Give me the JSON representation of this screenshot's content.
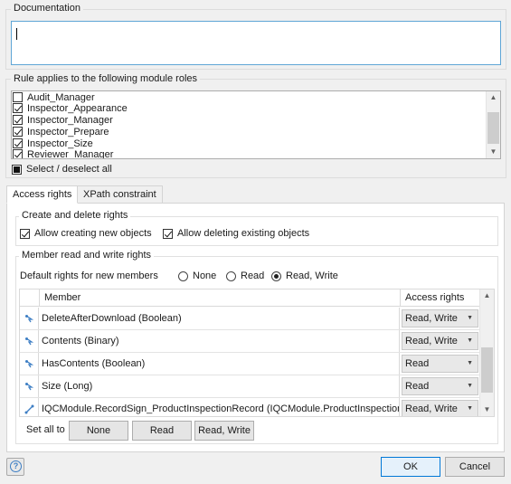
{
  "documentation": {
    "label": "Documentation",
    "value": ""
  },
  "roles": {
    "label": "Rule applies to the following module roles",
    "items": [
      {
        "label": "Audit_Manager",
        "checked": false
      },
      {
        "label": "Inspector_Appearance",
        "checked": true
      },
      {
        "label": "Inspector_Manager",
        "checked": true
      },
      {
        "label": "Inspector_Prepare",
        "checked": true
      },
      {
        "label": "Inspector_Size",
        "checked": true
      },
      {
        "label": "Reviewer_Manager",
        "checked": true
      }
    ],
    "select_all_label": "Select / deselect all"
  },
  "tabs": [
    {
      "label": "Access rights",
      "active": true
    },
    {
      "label": "XPath constraint",
      "active": false
    }
  ],
  "create_delete": {
    "title": "Create and delete rights",
    "allow_create_label": "Allow creating new objects",
    "allow_create_checked": true,
    "allow_delete_label": "Allow deleting existing objects",
    "allow_delete_checked": true
  },
  "member_rights": {
    "title": "Member read and write rights",
    "default_label": "Default rights for new members",
    "options": [
      "None",
      "Read",
      "Read, Write"
    ],
    "selected": "Read, Write",
    "columns": {
      "member": "Member",
      "access": "Access rights"
    },
    "rows": [
      {
        "icon": "attribute-icon",
        "member": "DeleteAfterDownload (Boolean)",
        "access": "Read, Write"
      },
      {
        "icon": "attribute-icon",
        "member": "Contents (Binary)",
        "access": "Read, Write"
      },
      {
        "icon": "attribute-icon",
        "member": "HasContents (Boolean)",
        "access": "Read"
      },
      {
        "icon": "attribute-icon",
        "member": "Size (Long)",
        "access": "Read"
      },
      {
        "icon": "association-icon",
        "member": "IQCModule.RecordSign_ProductInspectionRecord (IQCModule.ProductInspectionR...",
        "access": "Read, Write"
      }
    ],
    "set_all_label": "Set all to",
    "set_all_buttons": [
      "None",
      "Read",
      "Read, Write"
    ]
  },
  "footer": {
    "ok_label": "OK",
    "cancel_label": "Cancel",
    "help_glyph": "?"
  },
  "colors": {
    "focus_border": "#5fa6d6",
    "primary_border": "#0078d7",
    "icon_blue": "#3d7ec4"
  }
}
